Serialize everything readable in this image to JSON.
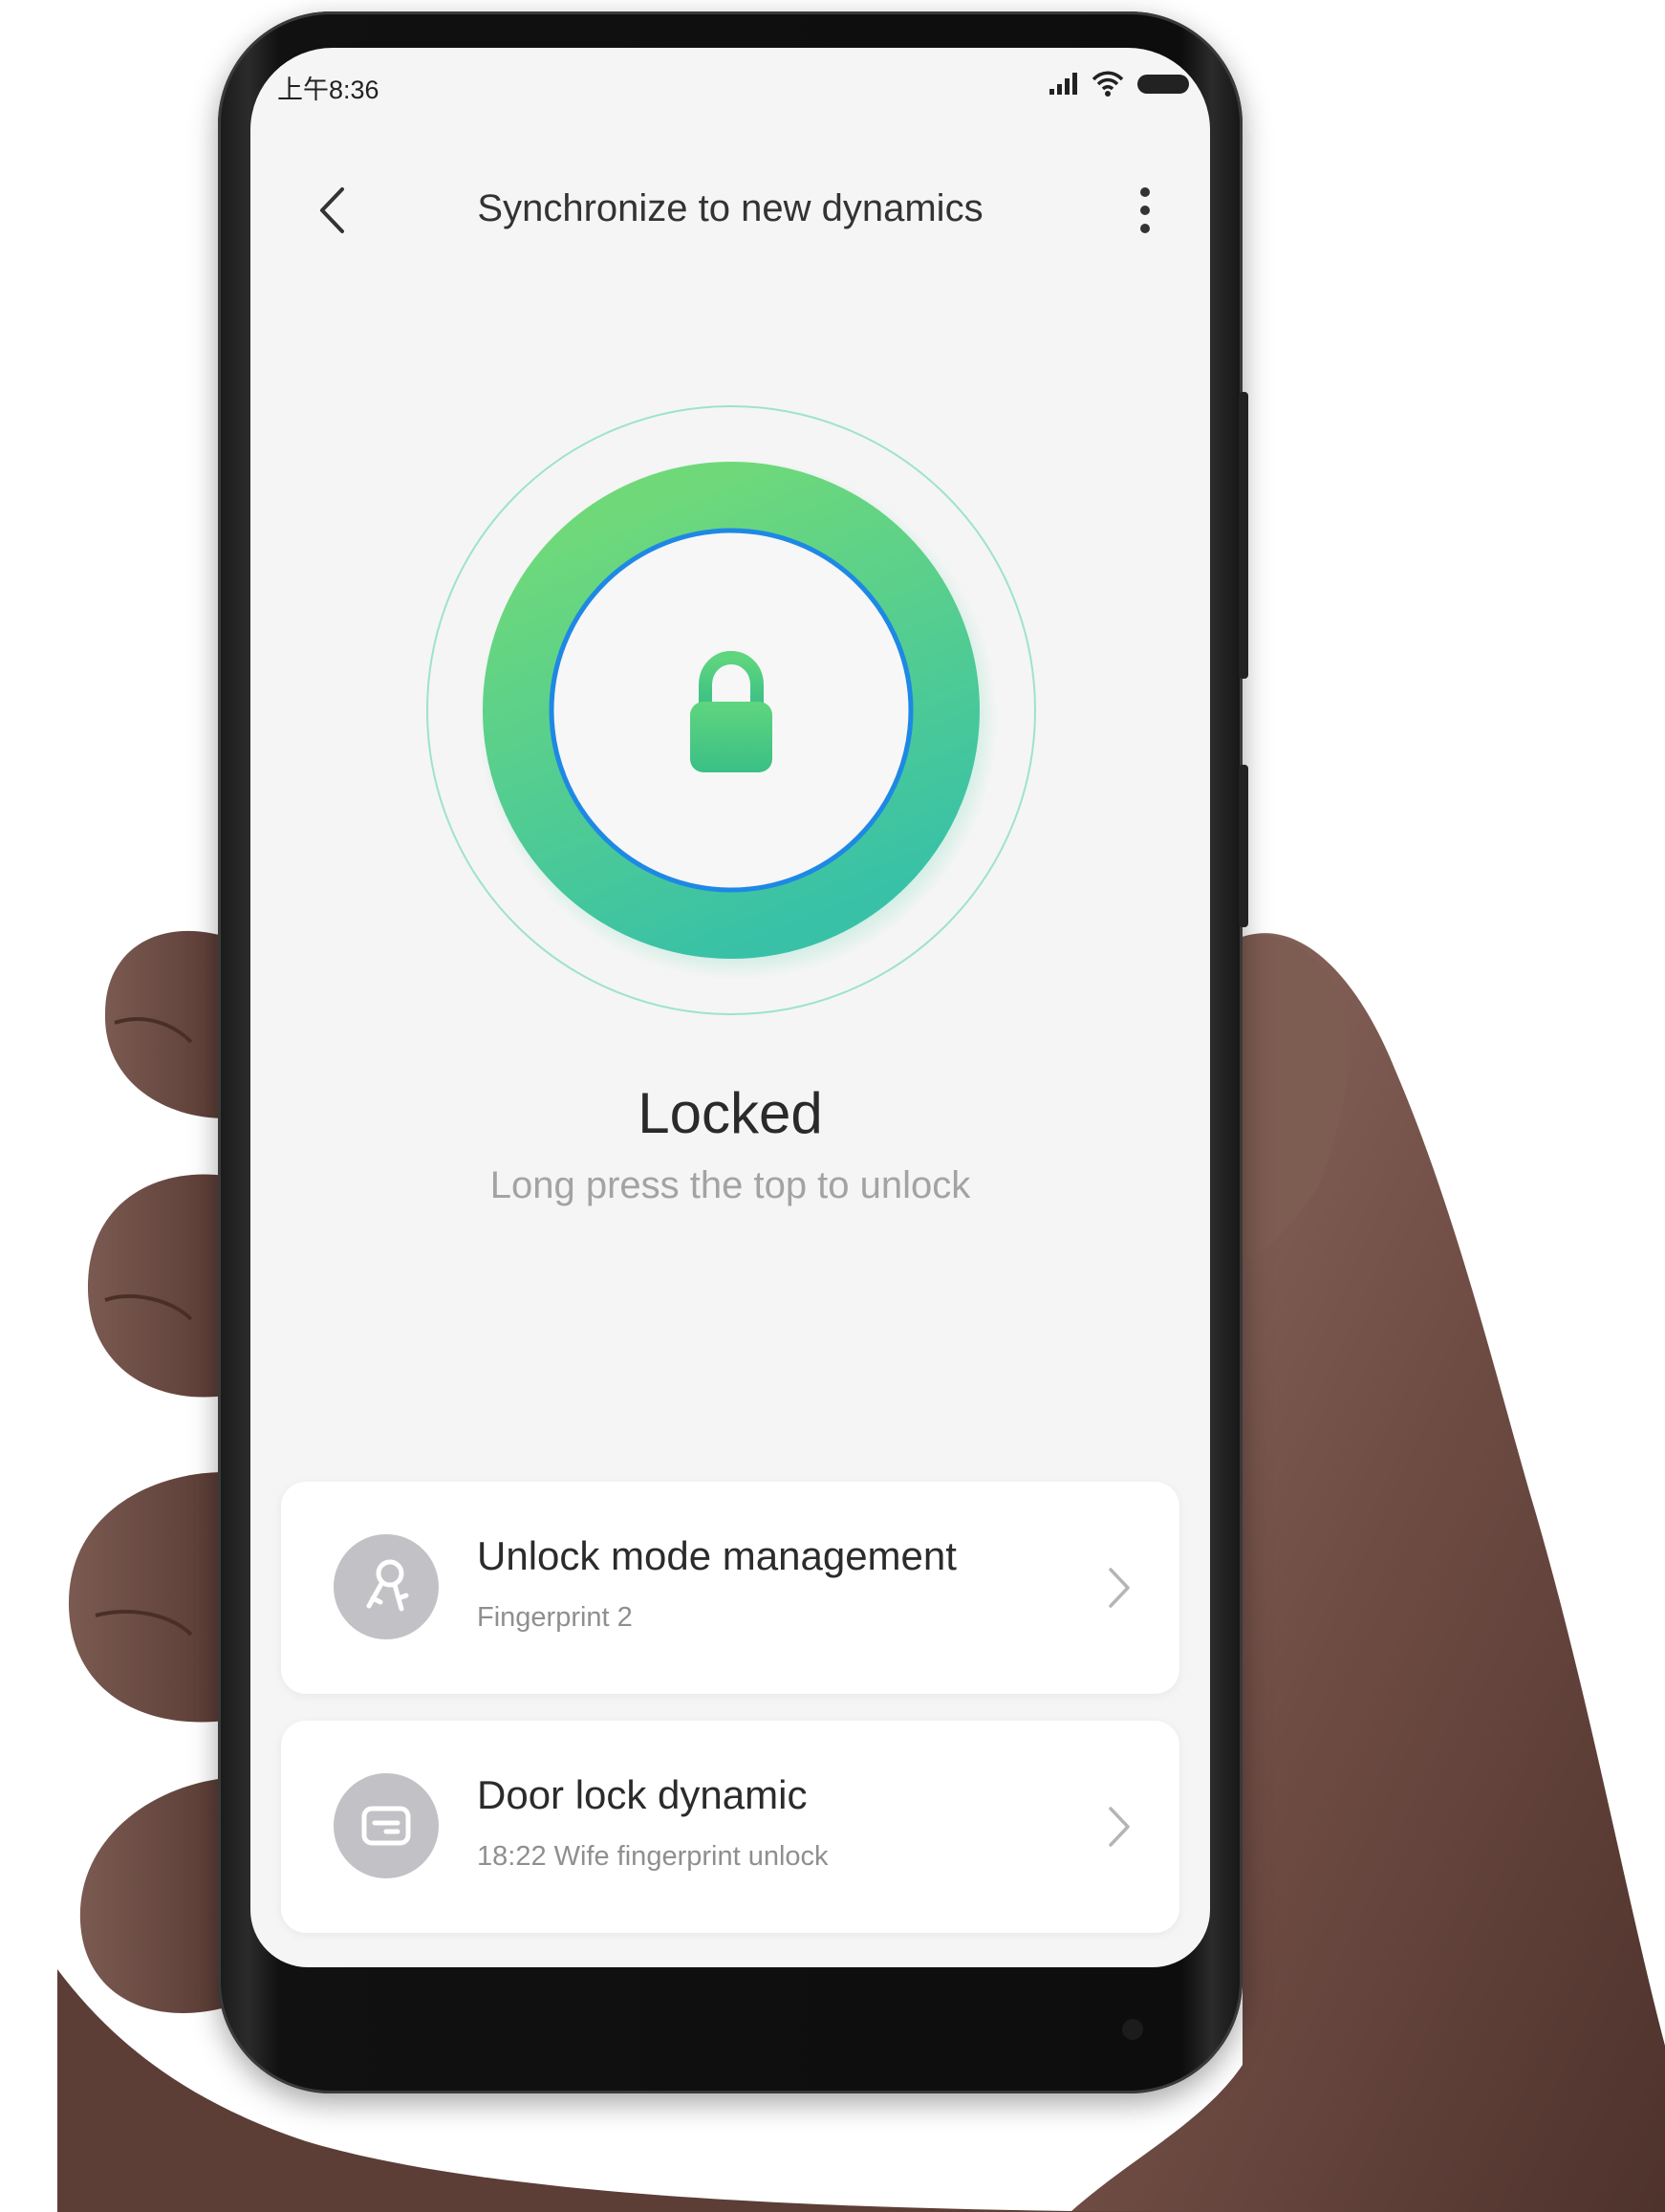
{
  "status_bar": {
    "time": "上午8:36"
  },
  "header": {
    "title": "Synchronize to new dynamics"
  },
  "lock": {
    "status": "Locked",
    "hint": "Long press the top to unlock"
  },
  "cards": [
    {
      "title": "Unlock mode management",
      "subtitle": "Fingerprint 2",
      "icon": "key-icon"
    },
    {
      "title": "Door lock dynamic",
      "subtitle": "18:22  Wife fingerprint unlock",
      "icon": "log-icon"
    }
  ],
  "colors": {
    "accent_green": "#4fce7e",
    "ring_teal": "#3ec4a6",
    "inner_blue": "#1e88e5",
    "icon_circle": "#c2c2c6",
    "screen_bg": "#f5f5f5"
  }
}
